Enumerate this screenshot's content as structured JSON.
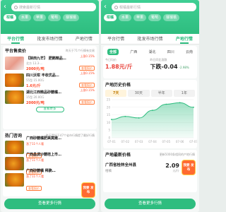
{
  "colors": {
    "accent": "#2ebd7f",
    "price": "#ff4a2a",
    "badge": "#ff6a30",
    "down": "#4aa46e",
    "rise": "#e8423a"
  },
  "left": {
    "search_placeholder": "搜索最新行情",
    "categories": [
      "柑橘",
      "水果",
      "苹果",
      "葡萄",
      "猕猴桃"
    ],
    "tabs": [
      "平台行情",
      "批发市场行情",
      "产地行情"
    ],
    "hot_sale": {
      "title": "平台售卖价",
      "note": "昨天于71个行情有交易",
      "items": [
        {
          "name": "【陕西九芒】 肥鹅精品…",
          "sub": "北方 13.3·…",
          "price": "2000元/吨",
          "up": "上涨0.15%",
          "btn": "查看报价"
        },
        {
          "name": "四川沃柑 丰收优品…",
          "sub": "55型 15.00斤",
          "price": "1.6元/斤",
          "up": "上涨0.15%",
          "btn": "查看报价"
        },
        {
          "name": "湖北江西精品砂糖橘…",
          "sub": "15型 20.00斤",
          "price": "2000元/吨",
          "up": "上涨0.15%",
          "btn": "查看报价"
        }
      ],
      "more": "查看更多"
    },
    "news": {
      "title": "热门咨询",
      "note": "昨天是好于47个省市行情提了最好行情",
      "items": [
        {
          "name": "广西砂糖橘肥美莫嫩…",
          "tag": "涨了11个人看",
          "btn": "查看报价"
        },
        {
          "name": "广西晶调沙糖桔上市…",
          "tag": "涨了11个人看",
          "btn": "查看报价"
        },
        {
          "name": "广西砂糖橘 稀脆…",
          "tag": "涨了11个人看",
          "btn": "查看报价"
        }
      ]
    },
    "badge": "我要\n发布",
    "bottom_button": "查看更多行情"
  },
  "right": {
    "search_placeholder": "柑橘最新行情",
    "categories": [
      "柑橘",
      "水果",
      "苹果",
      "葡萄",
      "猕猴桃"
    ],
    "tabs": [
      "平台行情",
      "批发市场行情",
      "产地行情"
    ],
    "regions": [
      "全部",
      "广西",
      "湖北",
      "四川",
      "云南"
    ],
    "stats": {
      "today_label": "今日均价",
      "today_value": "1.88元/斤",
      "change_label": "昨日同比涨跌",
      "change_value": "下跌-0.04",
      "change_pct": "-2.98%"
    },
    "history": {
      "title": "产地历史价格",
      "periods": [
        "7天",
        "30天",
        "半年",
        "1年"
      ]
    },
    "latest": {
      "title": "产地最新价格",
      "note": "更新5000条相同的产地行情",
      "region": "广西省桂林全州县",
      "product": "柑橘",
      "price": "2.09",
      "unit": "元/斤"
    },
    "badge": "我要\n发布",
    "bottom_button": "查看更多行情"
  },
  "chart_data": {
    "type": "area",
    "x": [
      "07-01",
      "07-02",
      "07-03",
      "07-04",
      "07-05",
      "07-06",
      "07-07"
    ],
    "series": [
      {
        "values": [
          12,
          14,
          13,
          18,
          22,
          23,
          20
        ]
      }
    ],
    "ylim": [
      0,
      25
    ],
    "yticks": [
      "25",
      "20",
      "15",
      "10",
      "5",
      "0"
    ],
    "grid": true
  }
}
